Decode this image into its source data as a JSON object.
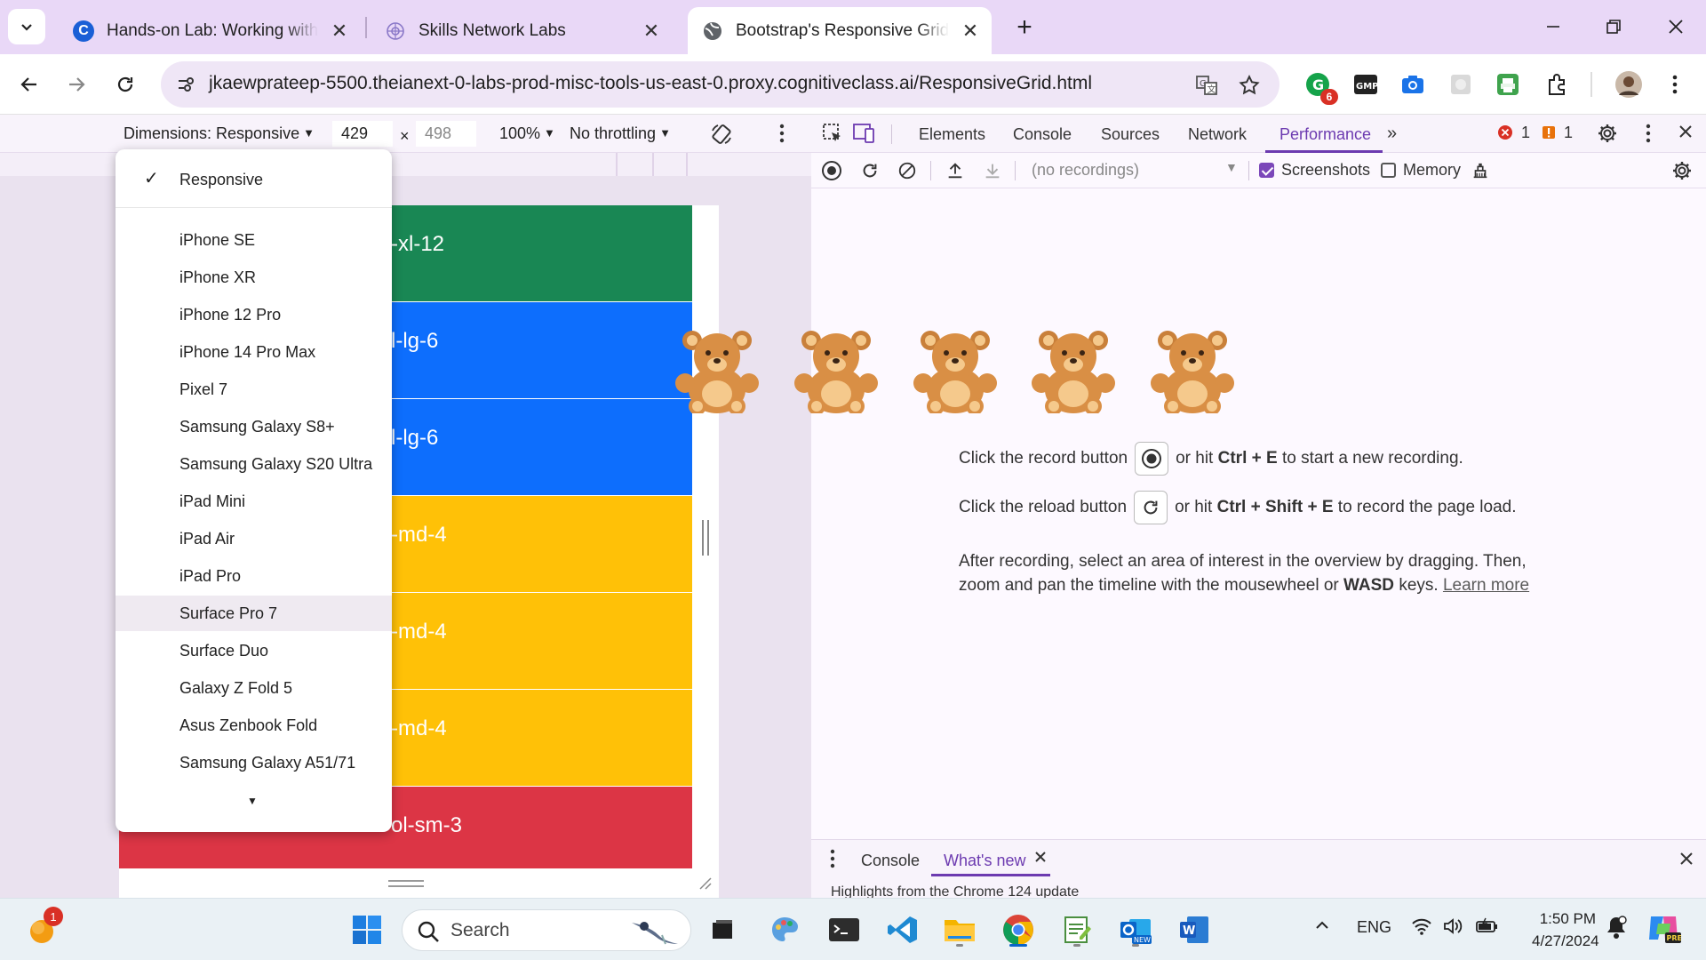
{
  "browser": {
    "tabs": [
      {
        "title": "Hands-on Lab: Working with the",
        "active": false
      },
      {
        "title": "Skills Network Labs",
        "active": false
      },
      {
        "title": "Bootstrap's Responsive Grid Sys",
        "active": true
      }
    ],
    "url": "jkaewprateep-5500.theianext-0-labs-prod-misc-tools-us-east-0.proxy.cognitiveclass.ai/ResponsiveGrid.html",
    "extension_badge": "6"
  },
  "device_toolbar": {
    "dimensions_label": "Dimensions: Responsive",
    "width": "429",
    "times": "×",
    "height": "498",
    "zoom": "100%",
    "throttling": "No throttling"
  },
  "device_menu": {
    "selected": "Responsive",
    "options": [
      "iPhone SE",
      "iPhone XR",
      "iPhone 12 Pro",
      "iPhone 14 Pro Max",
      "Pixel 7",
      "Samsung Galaxy S8+",
      "Samsung Galaxy S20 Ultra",
      "iPad Mini",
      "iPad Air",
      "iPad Pro",
      "Surface Pro 7",
      "Surface Duo",
      "Galaxy Z Fold 5",
      "Asus Zenbook Fold",
      "Samsung Galaxy A51/71"
    ],
    "highlighted": "Surface Pro 7"
  },
  "page_blocks": [
    {
      "label": "-xl-12",
      "color": "#198754"
    },
    {
      "label": "l-lg-6",
      "color": "#0d6efd"
    },
    {
      "label": "l-lg-6",
      "color": "#0d6efd"
    },
    {
      "label": "-md-4",
      "color": "#ffc107"
    },
    {
      "label": "-md-4",
      "color": "#ffc107"
    },
    {
      "label": "-md-4",
      "color": "#ffc107"
    },
    {
      "label": "ol-sm-3",
      "color": "#dc3545"
    }
  ],
  "devtools": {
    "tabs": [
      "Elements",
      "Console",
      "Sources",
      "Network",
      "Performance"
    ],
    "active_tab": "Performance",
    "errors": "1",
    "warnings": "1",
    "recordings_placeholder": "(no recordings)",
    "screenshots_label": "Screenshots",
    "memory_label": "Memory",
    "record_line": {
      "pre": "Click the record button",
      "mid": "or hit",
      "keys": "Ctrl + E",
      "post": "to start a new recording."
    },
    "reload_line": {
      "pre": "Click the reload button",
      "mid": "or hit",
      "keys": "Ctrl + Shift + E",
      "post": "to record the page load."
    },
    "after_line1": "After recording, select an area of interest in the overview by dragging. Then,",
    "after_line2_pre": "zoom and pan the timeline with the mousewheel or",
    "after_line2_keys": "WASD",
    "after_line2_post": "keys.",
    "learn_more": "Learn more",
    "drawer_tabs": [
      "Console",
      "What's new"
    ],
    "drawer_snippet": "Highlights from the Chrome 124 update"
  },
  "taskbar": {
    "search_label": "Search",
    "notification_count": "1",
    "language": "ENG",
    "time": "1:50 PM",
    "date": "4/27/2024"
  },
  "colors": {
    "accent": "#6c3ab0",
    "tabstrip": "#e9d8f7",
    "green": "#198754",
    "blue": "#0d6efd",
    "yellow": "#ffc107",
    "red": "#dc3545"
  }
}
